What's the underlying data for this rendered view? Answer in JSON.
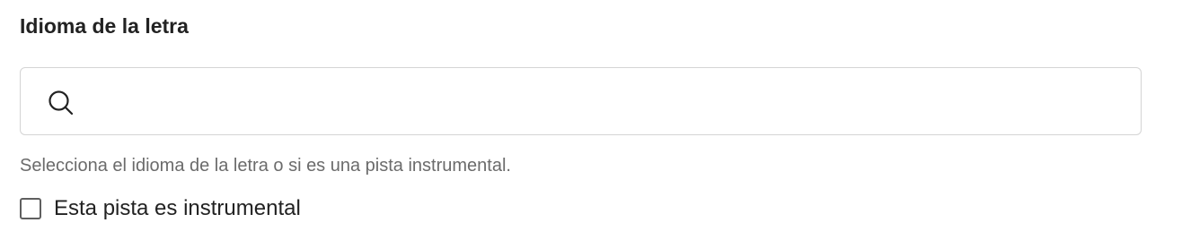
{
  "field": {
    "label": "Idioma de la letra",
    "search": {
      "value": "",
      "placeholder": "",
      "icon": "search-icon"
    },
    "helper_text": "Selecciona el idioma de la letra o si es una pista instrumental.",
    "instrumental_checkbox": {
      "label": "Esta pista es instrumental",
      "checked": false
    }
  },
  "colors": {
    "text": "#222222",
    "helper_text": "#6b6b6b",
    "border": "#d4d4d4",
    "checkbox_border": "#5f5f5f"
  }
}
